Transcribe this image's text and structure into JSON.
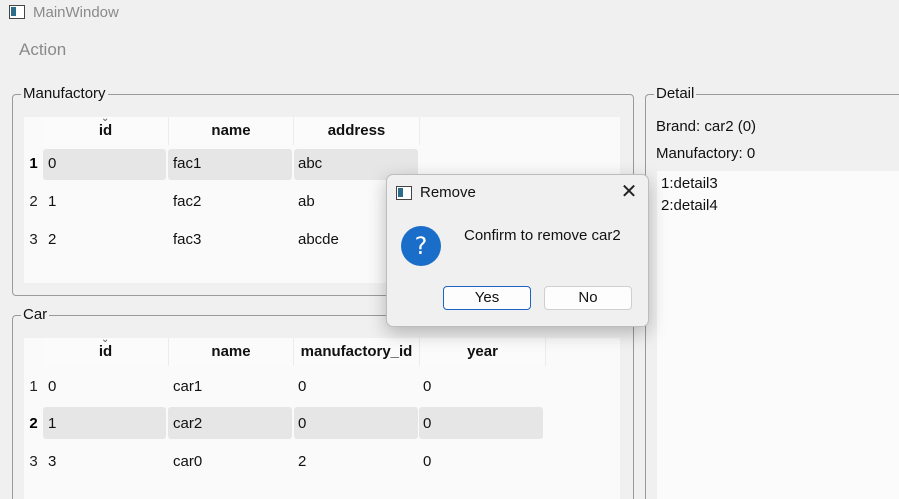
{
  "window": {
    "title": "MainWindow"
  },
  "menu": {
    "items": [
      "Action"
    ]
  },
  "manufactory": {
    "title": "Manufactory",
    "headers": [
      "id",
      "name",
      "address"
    ],
    "rows": [
      {
        "num": "1",
        "id": "0",
        "name": "fac1",
        "address": "abc",
        "selected": true
      },
      {
        "num": "2",
        "id": "1",
        "name": "fac2",
        "address": "ab",
        "selected": false
      },
      {
        "num": "3",
        "id": "2",
        "name": "fac3",
        "address": "abcde",
        "selected": false
      }
    ]
  },
  "car": {
    "title": "Car",
    "headers": [
      "id",
      "name",
      "manufactory_id",
      "year"
    ],
    "rows": [
      {
        "num": "1",
        "id": "0",
        "name": "car1",
        "manufactory_id": "0",
        "year": "0",
        "selected": false
      },
      {
        "num": "2",
        "id": "1",
        "name": "car2",
        "manufactory_id": "0",
        "year": "0",
        "selected": true
      },
      {
        "num": "3",
        "id": "3",
        "name": "car0",
        "manufactory_id": "2",
        "year": "0",
        "selected": false
      }
    ]
  },
  "detail": {
    "title": "Detail",
    "brand": "Brand: car2 (0)",
    "manufactory": "Manufactory: 0",
    "items": [
      "1:detail3",
      "2:detail4"
    ]
  },
  "dialog": {
    "title": "Remove",
    "message": "Confirm to remove car2",
    "yes_label": "Yes",
    "no_label": "No",
    "icon": "question-icon",
    "close_icon": "close-icon"
  },
  "colors": {
    "background": "#f0f0f0",
    "accent": "#1e63c2",
    "question_icon": "#1a6dc9",
    "selected_row": "#e6e6e6"
  }
}
